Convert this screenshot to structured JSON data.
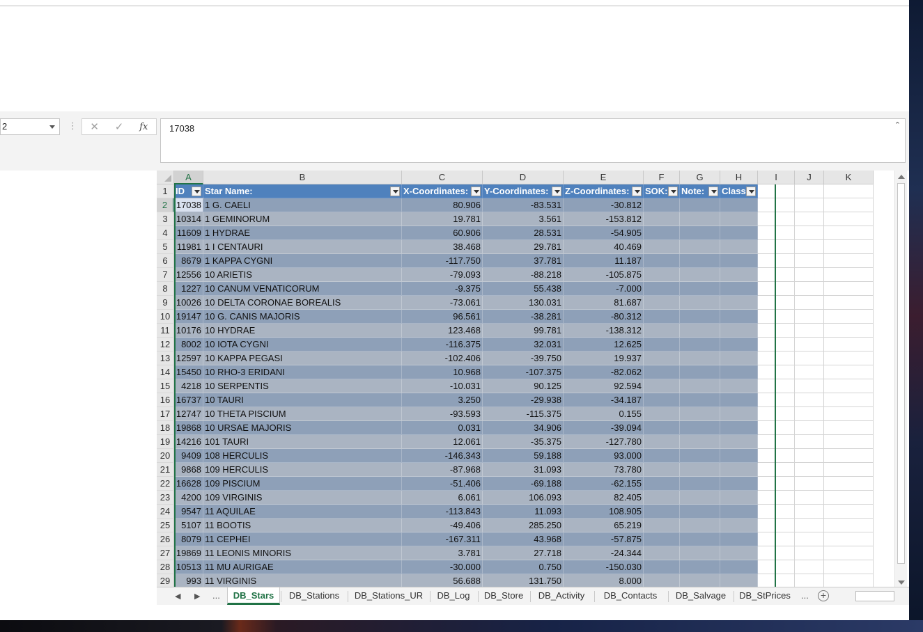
{
  "formula_bar": {
    "name_box": "2",
    "cancel_icon": "✕",
    "enter_icon": "✓",
    "fx_label": "fx",
    "formula_value": "17038"
  },
  "columns": [
    "A",
    "B",
    "C",
    "D",
    "E",
    "F",
    "G",
    "H",
    "I",
    "J",
    "K"
  ],
  "table": {
    "headers": [
      "ID",
      "Star Name:",
      "X-Coordinates:",
      "Y-Coordinates:",
      "Z-Coordinates:",
      "SOK:",
      "Note:",
      "Class"
    ],
    "rows": [
      {
        "id": "17038",
        "name": "1 G. CAELI",
        "x": "80.906",
        "y": "-83.531",
        "z": "-30.812"
      },
      {
        "id": "10314",
        "name": "1 GEMINORUM",
        "x": "19.781",
        "y": "3.561",
        "z": "-153.812"
      },
      {
        "id": "11609",
        "name": "1 HYDRAE",
        "x": "60.906",
        "y": "28.531",
        "z": "-54.905"
      },
      {
        "id": "11981",
        "name": "1 I CENTAURI",
        "x": "38.468",
        "y": "29.781",
        "z": "40.469"
      },
      {
        "id": "8679",
        "name": "1 KAPPA CYGNI",
        "x": "-117.750",
        "y": "37.781",
        "z": "11.187"
      },
      {
        "id": "12556",
        "name": "10 ARIETIS",
        "x": "-79.093",
        "y": "-88.218",
        "z": "-105.875"
      },
      {
        "id": "1227",
        "name": "10 CANUM VENATICORUM",
        "x": "-9.375",
        "y": "55.438",
        "z": "-7.000"
      },
      {
        "id": "10026",
        "name": "10 DELTA CORONAE BOREALIS",
        "x": "-73.061",
        "y": "130.031",
        "z": "81.687"
      },
      {
        "id": "19147",
        "name": "10 G. CANIS MAJORIS",
        "x": "96.561",
        "y": "-38.281",
        "z": "-80.312"
      },
      {
        "id": "10176",
        "name": "10 HYDRAE",
        "x": "123.468",
        "y": "99.781",
        "z": "-138.312"
      },
      {
        "id": "8002",
        "name": "10 IOTA CYGNI",
        "x": "-116.375",
        "y": "32.031",
        "z": "12.625"
      },
      {
        "id": "12597",
        "name": "10 KAPPA PEGASI",
        "x": "-102.406",
        "y": "-39.750",
        "z": "19.937"
      },
      {
        "id": "15450",
        "name": "10 RHO-3 ERIDANI",
        "x": "10.968",
        "y": "-107.375",
        "z": "-82.062"
      },
      {
        "id": "4218",
        "name": "10 SERPENTIS",
        "x": "-10.031",
        "y": "90.125",
        "z": "92.594"
      },
      {
        "id": "16737",
        "name": "10 TAURI",
        "x": "3.250",
        "y": "-29.938",
        "z": "-34.187"
      },
      {
        "id": "12747",
        "name": "10 THETA PISCIUM",
        "x": "-93.593",
        "y": "-115.375",
        "z": "0.155"
      },
      {
        "id": "19868",
        "name": "10 URSAE MAJORIS",
        "x": "0.031",
        "y": "34.906",
        "z": "-39.094"
      },
      {
        "id": "14216",
        "name": "101 TAURI",
        "x": "12.061",
        "y": "-35.375",
        "z": "-127.780"
      },
      {
        "id": "9409",
        "name": "108 HERCULIS",
        "x": "-146.343",
        "y": "59.188",
        "z": "93.000"
      },
      {
        "id": "9868",
        "name": "109 HERCULIS",
        "x": "-87.968",
        "y": "31.093",
        "z": "73.780"
      },
      {
        "id": "16628",
        "name": "109 PISCIUM",
        "x": "-51.406",
        "y": "-69.188",
        "z": "-62.155"
      },
      {
        "id": "4200",
        "name": "109 VIRGINIS",
        "x": "6.061",
        "y": "106.093",
        "z": "82.405"
      },
      {
        "id": "9547",
        "name": "11 AQUILAE",
        "x": "-113.843",
        "y": "11.093",
        "z": "108.905"
      },
      {
        "id": "5107",
        "name": "11 BOOTIS",
        "x": "-49.406",
        "y": "285.250",
        "z": "65.219"
      },
      {
        "id": "8079",
        "name": "11 CEPHEI",
        "x": "-167.311",
        "y": "43.968",
        "z": "-57.875"
      },
      {
        "id": "19869",
        "name": "11 LEONIS MINORIS",
        "x": "3.781",
        "y": "27.718",
        "z": "-24.344"
      },
      {
        "id": "10513",
        "name": "11 MU AURIGAE",
        "x": "-30.000",
        "y": "0.750",
        "z": "-150.030"
      },
      {
        "id": "993",
        "name": "11 VIRGINIS",
        "x": "56.688",
        "y": "131.750",
        "z": "8.000"
      }
    ]
  },
  "sheet_tabs": {
    "items": [
      "DB_Stars",
      "DB_Stations",
      "DB_Stations_UR",
      "DB_Log",
      "DB_Store",
      "DB_Activity",
      "DB_Contacts",
      "DB_Salvage",
      "DB_StPrices"
    ],
    "active": "DB_Stars",
    "ellipsis": "...",
    "add_icon": "+"
  },
  "colors": {
    "header_blue": "#4f81bd",
    "band_dark": "#8ea0b8",
    "band_light": "#aab4c2",
    "excel_green": "#217346"
  }
}
